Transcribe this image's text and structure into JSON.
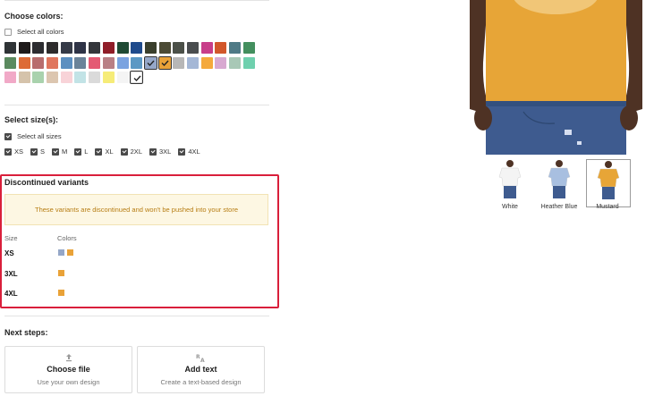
{
  "colors_section": {
    "title": "Choose colors:",
    "select_all_label": "Select all colors",
    "swatches": [
      {
        "hex": "#2f3336",
        "selected": false
      },
      {
        "hex": "#1e1a1a",
        "selected": false
      },
      {
        "hex": "#2c2c30",
        "selected": false
      },
      {
        "hex": "#2d2b2c",
        "selected": false
      },
      {
        "hex": "#353a47",
        "selected": false
      },
      {
        "hex": "#2e3346",
        "selected": false
      },
      {
        "hex": "#34363b",
        "selected": false
      },
      {
        "hex": "#8f1d28",
        "selected": false
      },
      {
        "hex": "#1f4a34",
        "selected": false
      },
      {
        "hex": "#1f4b8c",
        "selected": false
      },
      {
        "hex": "#3a3f2c",
        "selected": false
      },
      {
        "hex": "#4c4b35",
        "selected": false
      },
      {
        "hex": "#4b5048",
        "selected": false
      },
      {
        "hex": "#4a4d4f",
        "selected": false
      },
      {
        "hex": "#c83e8a",
        "selected": false
      },
      {
        "hex": "#d2572b",
        "selected": false
      },
      {
        "hex": "#4f7a86",
        "selected": false
      },
      {
        "hex": "#438f5e",
        "selected": false
      },
      {
        "hex": "#5b8a5f",
        "selected": false
      },
      {
        "hex": "#dd6b36",
        "selected": false
      },
      {
        "hex": "#b86d6d",
        "selected": false
      },
      {
        "hex": "#e0765d",
        "selected": false
      },
      {
        "hex": "#5c8fc0",
        "selected": false
      },
      {
        "hex": "#6b8399",
        "selected": false
      },
      {
        "hex": "#e45a73",
        "selected": false
      },
      {
        "hex": "#b97f85",
        "selected": false
      },
      {
        "hex": "#7aa3e0",
        "selected": false
      },
      {
        "hex": "#5b98c4",
        "selected": false
      },
      {
        "hex": "#95a7c8",
        "selected": true
      },
      {
        "hex": "#e9a238",
        "selected": true
      },
      {
        "hex": "#b7b7b7",
        "selected": false
      },
      {
        "hex": "#a4b7d6",
        "selected": false
      },
      {
        "hex": "#f4a93c",
        "selected": false
      },
      {
        "hex": "#d8a9d1",
        "selected": false
      },
      {
        "hex": "#a8c8b6",
        "selected": false
      },
      {
        "hex": "#6fd0ae",
        "selected": false
      },
      {
        "hex": "#f1a9c7",
        "selected": false
      },
      {
        "hex": "#d5c3ab",
        "selected": false
      },
      {
        "hex": "#a9d2ad",
        "selected": false
      },
      {
        "hex": "#dcc6b0",
        "selected": false
      },
      {
        "hex": "#f8d3d8",
        "selected": false
      },
      {
        "hex": "#c2e3e6",
        "selected": false
      },
      {
        "hex": "#dadada",
        "selected": false
      },
      {
        "hex": "#f6ec78",
        "selected": false
      },
      {
        "hex": "#f4f4f4",
        "selected": false
      },
      {
        "hex": "#ffffff",
        "selected": true
      }
    ]
  },
  "sizes_section": {
    "title": "Select size(s):",
    "select_all_label": "Select all sizes",
    "sizes": [
      "XS",
      "S",
      "M",
      "L",
      "XL",
      "2XL",
      "3XL",
      "4XL"
    ]
  },
  "discontinued": {
    "title": "Discontinued variants",
    "warning": "These variants are discontinued and won't be pushed into your store",
    "col_size": "Size",
    "col_colors": "Colors",
    "rows": [
      {
        "size": "XS",
        "colors": [
          "#95a7c8",
          "#e9a238"
        ]
      },
      {
        "size": "3XL",
        "colors": [
          "#e9a238"
        ]
      },
      {
        "size": "4XL",
        "colors": [
          "#e9a238"
        ]
      }
    ]
  },
  "next_steps": {
    "title": "Next steps:",
    "cards": [
      {
        "title": "Choose file",
        "subtitle": "Use your own design",
        "icon": "upload-icon"
      },
      {
        "title": "Add text",
        "subtitle": "Create a text-based design",
        "icon": "text-icon"
      }
    ]
  },
  "preview": {
    "thumbnails": [
      {
        "label": "White",
        "color": "#f4f4f4",
        "selected": false
      },
      {
        "label": "Heather Blue",
        "color": "#a8bfe0",
        "selected": false
      },
      {
        "label": "Mustard",
        "color": "#e7a537",
        "selected": true
      }
    ],
    "shirt_color": "#e7a537",
    "jeans_color": "#3e5b8f",
    "skin_color": "#5a3a28"
  }
}
